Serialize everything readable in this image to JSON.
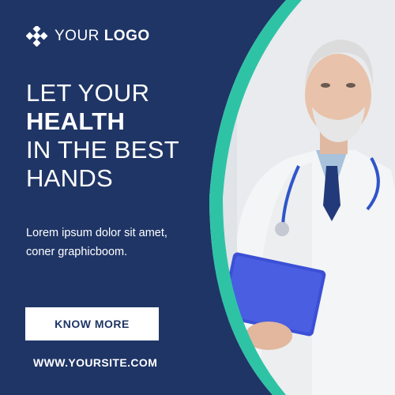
{
  "brand": {
    "logo_word1": "YOUR",
    "logo_word2": "LOGO",
    "logo_icon": "diamond-cluster-icon"
  },
  "headline": {
    "line1": "LET YOUR",
    "line2": "HEALTH",
    "line3": "IN THE BEST",
    "line4": "HANDS"
  },
  "body": {
    "text": "Lorem ipsum dolor sit amet, coner graphicboom."
  },
  "cta": {
    "label": "KNOW MORE"
  },
  "footer": {
    "url": "WWW.YOURSITE.COM"
  },
  "colors": {
    "navy": "#1f3566",
    "teal": "#2fc3a6",
    "white": "#ffffff",
    "background_photo": "#dfe2e6"
  }
}
